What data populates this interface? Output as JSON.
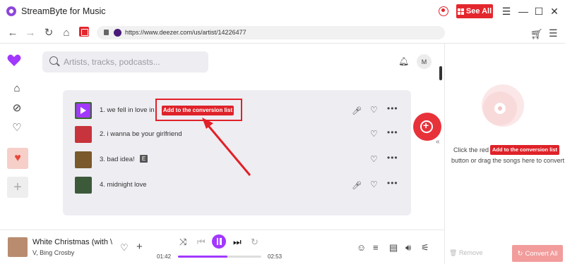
{
  "window": {
    "title": "StreamByte for Music",
    "see_all_label": "See All"
  },
  "browser": {
    "url": "https://www.deezer.com/us/artist/14226477"
  },
  "search": {
    "placeholder": "Artists, tracks, podcasts..."
  },
  "account": {
    "initial": "M"
  },
  "tracks": [
    {
      "title": "1. we fell in love in",
      "mic": true,
      "cover": "#3a6a2a"
    },
    {
      "title": "2. i wanna be your girlfriend",
      "mic": false,
      "cover": "#c7343c"
    },
    {
      "title": "3. bad idea!",
      "explicit": "E",
      "mic": false,
      "cover": "#7a5a2a"
    },
    {
      "title": "4. midnight love",
      "mic": true,
      "cover": "#3c5a3a"
    }
  ],
  "overlay": {
    "add_button_label": "Add to the conversion list"
  },
  "right_panel": {
    "hint_prefix": "Click the red",
    "add_button_label": "Add to the conversion list",
    "hint_suffix": "button or drag the songs here to convert",
    "remove_label": "Remove",
    "convert_label": "Convert All"
  },
  "player": {
    "title": "White Christmas (with \\",
    "artist": "V, Bing Crosby",
    "elapsed": "01:42",
    "duration": "02:53",
    "progress_fraction": 0.59
  },
  "colors": {
    "accent_red": "#e4262d",
    "deezer_purple": "#a238ff"
  },
  "icons": [
    "user-icon",
    "grid-icon",
    "menu-icon",
    "minimize-icon",
    "maximize-icon",
    "close-icon",
    "back-icon",
    "forward-icon",
    "reload-icon",
    "home-icon",
    "lock-icon",
    "cart-icon",
    "search-icon",
    "bell-icon",
    "microphone-icon",
    "heart-icon",
    "more-icon",
    "shuffle-icon",
    "previous-icon",
    "pause-icon",
    "next-icon",
    "repeat-icon"
  ]
}
